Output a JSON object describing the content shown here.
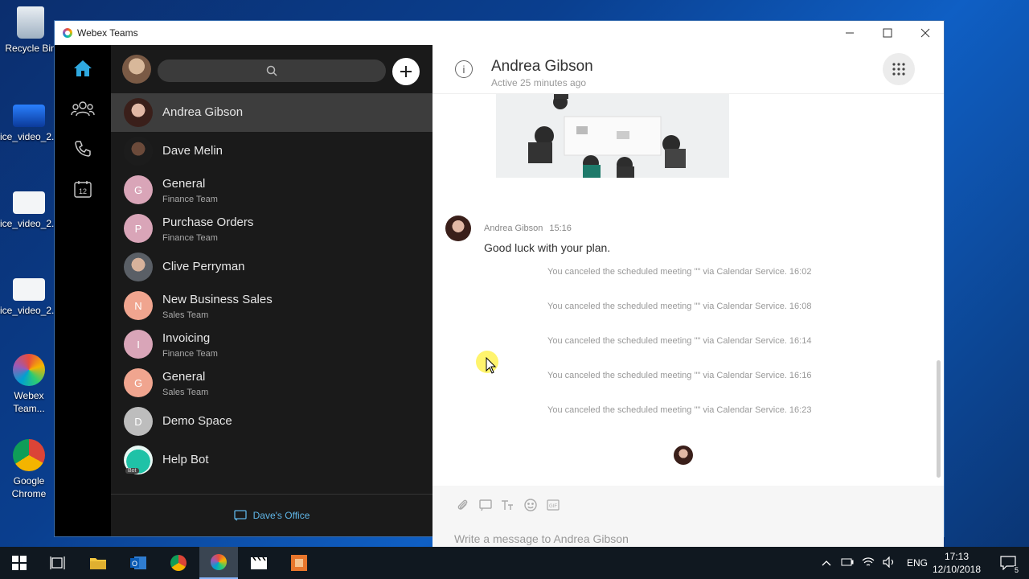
{
  "desktop": {
    "icons": [
      {
        "label": "Recycle Bin"
      },
      {
        "label": "ice_video_2..."
      },
      {
        "label": "ice_video_2..."
      },
      {
        "label": "ice_video_2..."
      },
      {
        "label": "Webex Team..."
      },
      {
        "label": "Google Chrome"
      }
    ]
  },
  "window": {
    "title": "Webex Teams",
    "controls": {
      "minimize": "—",
      "maximize": "☐",
      "close": "✕"
    }
  },
  "rail": {
    "items": [
      {
        "icon": "home-icon",
        "active": true
      },
      {
        "icon": "people-icon"
      },
      {
        "icon": "phone-icon"
      },
      {
        "icon": "calendar-icon",
        "label": "12"
      }
    ]
  },
  "spaces": {
    "search_icon": "search-icon",
    "items": [
      {
        "name": "Andrea Gibson",
        "sub": "",
        "initial": "",
        "color": "#7a3b35",
        "active": true
      },
      {
        "name": "Dave Melin",
        "sub": "",
        "initial": "",
        "color": "#2b2b2b"
      },
      {
        "name": "General",
        "sub": "Finance Team",
        "initial": "G",
        "color": "#d9a5b8"
      },
      {
        "name": "Purchase Orders",
        "sub": "Finance Team",
        "initial": "P",
        "color": "#d9a5b8"
      },
      {
        "name": "Clive Perryman",
        "sub": "",
        "initial": "",
        "color": "#8a8f95"
      },
      {
        "name": "New Business Sales",
        "sub": "Sales Team",
        "initial": "N",
        "color": "#f0a58f"
      },
      {
        "name": "Invoicing",
        "sub": "Finance Team",
        "initial": "I",
        "color": "#d9a5b8"
      },
      {
        "name": "General",
        "sub": "Sales Team",
        "initial": "G",
        "color": "#f0a58f"
      },
      {
        "name": "Demo Space",
        "sub": "",
        "initial": "D",
        "color": "#bdbdbd"
      },
      {
        "name": "Help Bot",
        "sub": "",
        "initial": "",
        "color": "#1fc2a7",
        "badge": "Bot"
      }
    ],
    "footer": "Dave's Office"
  },
  "conversation": {
    "title": "Andrea Gibson",
    "status": "Active 25 minutes ago",
    "message": {
      "author": "Andrea Gibson",
      "time": "15:16",
      "text": "Good luck with your plan."
    },
    "system_messages": [
      "You canceled the scheduled meeting \"\" via Calendar Service. 16:02",
      "You canceled the scheduled meeting \"\" via Calendar Service. 16:08",
      "You canceled the scheduled meeting \"\" via Calendar Service. 16:14",
      "You canceled the scheduled meeting \"\" via Calendar Service. 16:16",
      "You canceled the scheduled meeting \"\" via Calendar Service. 16:23"
    ],
    "composer_placeholder": "Write a message to Andrea Gibson",
    "tools": [
      "attach-icon",
      "whiteboard-icon",
      "format-icon",
      "emoji-icon",
      "gif-icon"
    ]
  },
  "taskbar": {
    "language": "ENG",
    "time": "17:13",
    "date": "12/10/2018",
    "notifications": "5"
  }
}
